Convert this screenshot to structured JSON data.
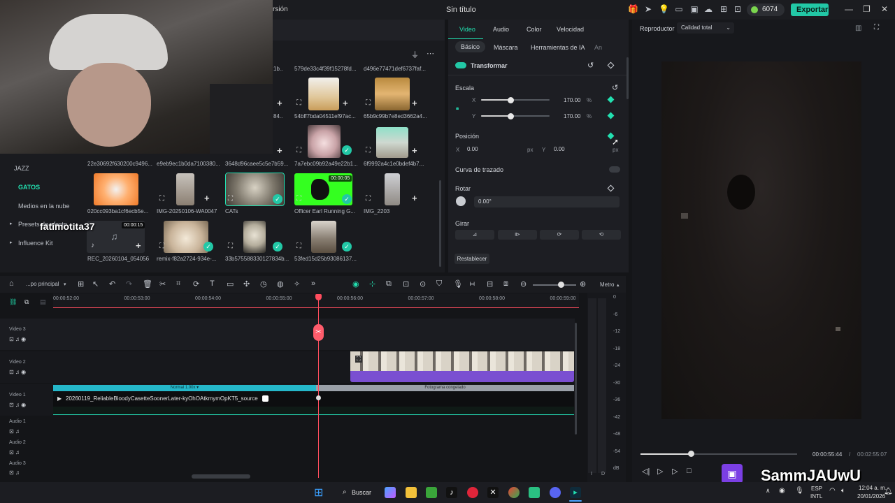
{
  "titlebar": {
    "title": "Sin título",
    "version_text": "rsión",
    "credits": "6074",
    "export_label": "Exportar"
  },
  "media": {
    "sidebar": [
      {
        "label": "JAZZ",
        "active": false
      },
      {
        "label": "GATOS",
        "active": true
      },
      {
        "label": "Medios en la nube",
        "active": false
      },
      {
        "label": "Presets de efecto",
        "active": false
      },
      {
        "label": "Influence Kit",
        "active": false
      }
    ],
    "top_labels": [
      "1b...",
      "579de33c4f39f15278fd...",
      "d496e77471def6737faf..."
    ],
    "row1_labels": [
      "84...",
      "54bff7bda04511ef97ac...",
      "65b9c99b7e8ed3662a4..."
    ],
    "row2_labels": [
      "22e30692f630200c9496...",
      "e9eb9ec1b0da7100380...",
      "3648d96caee5c5e7b59...",
      "7a7ebc09b92a49e22b1...",
      "6f9992a4c1e0bdef4b7..."
    ],
    "row3_labels": [
      "020cc093ba1cf6ecb5e...",
      "IMG-20250106-WA0047",
      "CATs",
      "Officer Earl Running G...",
      "IMG_2203"
    ],
    "row4_labels": [
      "REC_20260104_054056",
      "remix-f82a2724-934e-...",
      "33b575588330127834b...",
      "53fed15d25b93086137..."
    ],
    "durations": [
      "00:00:05",
      "00:00:15"
    ],
    "overlay_name": "fatimotita37"
  },
  "props": {
    "tabs": [
      "Video",
      "Audio",
      "Color",
      "Velocidad"
    ],
    "subtabs": [
      "Básico",
      "Máscara",
      "Herramientas de IA",
      "An"
    ],
    "transform_label": "Transformar",
    "scale_label": "Escala",
    "scale_x_label": "X",
    "scale_y_label": "Y",
    "scale_x": "170.00",
    "scale_y": "170.00",
    "percent": "%",
    "scale_x_fraction": 0.43,
    "scale_y_fraction": 0.43,
    "position_label": "Posición",
    "pos_x_label": "X",
    "pos_y_label": "Y",
    "pos_x": "0.00",
    "pos_y": "0.00",
    "unit": "px",
    "path_curve_label": "Curva de trazado",
    "rotate_label": "Rotar",
    "rotate_value": "0.00°",
    "flip_label": "Girar",
    "reset_label": "Restablecer"
  },
  "preview": {
    "label": "Reproductor",
    "quality": "Calidad total",
    "current_time": "00:00:55:44",
    "total_time": "00:02:55:07",
    "progress_fraction": 0.32,
    "streamer_name": "SammJAUwU"
  },
  "timeline": {
    "project": "...po principal",
    "meter_label": "Metro",
    "ticks": [
      "00:00:52:00",
      "00:00:53:00",
      "00:00:54:00",
      "00:00:55:00",
      "00:00:56:00",
      "00:00:57:00",
      "00:00:58:00",
      "00:00:59:00"
    ],
    "tracks": [
      "Video 3",
      "Video 2",
      "Video 1",
      "Audio 1",
      "Audio 2",
      "Audio 3"
    ],
    "speed_label": "Normal 1.00x",
    "freeze_label": "Fotograma congelado",
    "clip_name": "20260119_ReliableBloodyCasetteSoonerLater-kyOhOAtkmymOpKT5_source",
    "db_scale": [
      "0",
      "-6",
      "-12",
      "-18",
      "-24",
      "-30",
      "-36",
      "-42",
      "-48",
      "-54",
      "dB"
    ],
    "meter_lr": [
      "I",
      "D"
    ]
  },
  "taskbar": {
    "search": "Buscar",
    "lang1": "ESP",
    "lang2": "INTL",
    "time": "12:04 a. m.",
    "date": "20/01/2026"
  }
}
